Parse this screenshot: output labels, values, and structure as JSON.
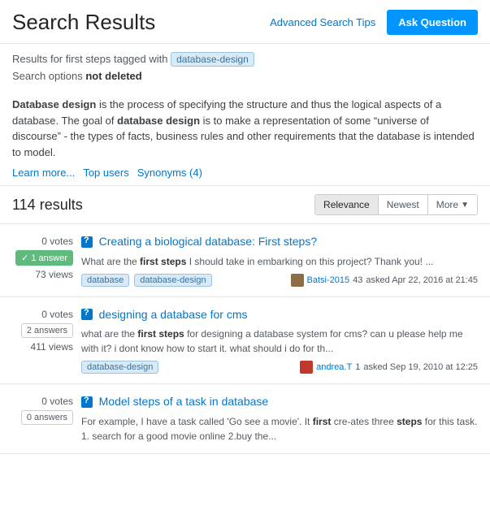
{
  "header": {
    "title": "Search Results",
    "advanced_search_link": "Advanced Search Tips",
    "ask_question_label": "Ask Question"
  },
  "search_info": {
    "results_for_prefix": "Results for first steps tagged with",
    "tag": "database-design",
    "search_options_prefix": "Search options",
    "search_options_value": "not deleted"
  },
  "description": {
    "text_parts": [
      "Database design",
      " is the process of specifying the structure and thus the logical aspects of a database. The goal of ",
      "database design",
      " is to make a representation of some \"universe of discourse\" - the types of facts, business rules and other requirements that the database is intended to model."
    ],
    "links": [
      {
        "label": "Learn more...",
        "href": "#"
      },
      {
        "label": "Top users",
        "href": "#"
      },
      {
        "label": "Synonyms (4)",
        "href": "#"
      }
    ]
  },
  "results_bar": {
    "count": "114 results",
    "sort_options": [
      {
        "label": "Relevance",
        "active": true
      },
      {
        "label": "Newest",
        "active": false
      },
      {
        "label": "More",
        "active": false,
        "has_arrow": true
      }
    ]
  },
  "questions": [
    {
      "votes": "0 votes",
      "answers": "1 answer",
      "answers_accepted": true,
      "views": "73 views",
      "title": "Creating a biological database: First steps?",
      "excerpt_parts": [
        "What are the ",
        "first steps",
        " I should take in embarking on this project? Thank you! ..."
      ],
      "tags": [
        "database",
        "database-design"
      ],
      "user_name": "Batsi-2015",
      "user_rep": "43",
      "asked_text": "asked Apr 22, 2016 at 21:45",
      "avatar_color": "blue"
    },
    {
      "votes": "0 votes",
      "answers": "2 answers",
      "answers_accepted": false,
      "views": "411 views",
      "title": "designing a database for cms",
      "excerpt_parts": [
        "what are the ",
        "first steps",
        " for designing a database system for cms? can u please help me with it? i dont know how to start it. what should i do for th..."
      ],
      "tags": [
        "database-design"
      ],
      "user_name": "andrea.T",
      "user_rep": "1",
      "asked_text": "asked Sep 19, 2010 at 12:25",
      "avatar_color": "red"
    },
    {
      "votes": "0 votes",
      "answers": "0 answers",
      "answers_accepted": false,
      "views": "",
      "title": "Model steps of a task in database",
      "excerpt_parts": [
        "For example, I have a task called 'Go see a movie'. It ",
        "first",
        " cre-ates three ",
        "steps",
        " for this task. 1. search for a good movie online 2.buy the..."
      ],
      "tags": [],
      "user_name": "",
      "user_rep": "",
      "asked_text": "",
      "avatar_color": "green"
    }
  ]
}
